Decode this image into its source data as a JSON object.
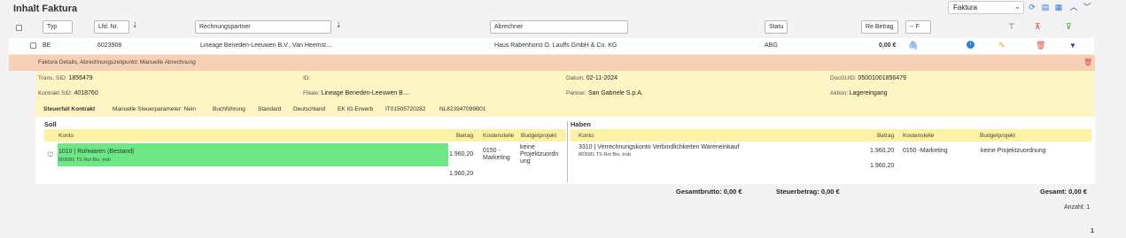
{
  "page": {
    "title": "Inhalt Faktura"
  },
  "toolbar": {
    "view_select": "Faktura"
  },
  "filters": {
    "typ": "Typ",
    "lfd_nr": "Lfd. Nr.",
    "rechnungspartner": "Rechnungspartner",
    "abrechner": "Abrechner",
    "status": "Statu",
    "re_betrag": "Re.Betrag",
    "f_select": "-- F"
  },
  "row": {
    "typ": "BE",
    "lfd_nr": "6023908",
    "rechnungspartner": "Lineage Beneden-Leeuwen B.V., Van Heemst…",
    "abrechner": "Haus Rabenhorst O. Lauffs GmbH & Co. KG",
    "status": "ABG",
    "betrag": "0,00 €"
  },
  "details": {
    "header": "Faktura Details, Abrechnungszeitpunkt: Manuelle Abrechnung",
    "trans_sid_label": "Trans. SID:",
    "trans_sid": "1856479",
    "id_label": "ID:",
    "id": "",
    "datum_label": "Datum:",
    "datum": "02-11-2024",
    "docguid_label": "DocGUID:",
    "docguid": "05001001856479",
    "kontrakt_label": "Kontrakt SID:",
    "kontrakt": "4018760",
    "filiale_label": "Filiale:",
    "filiale": "Lineage Beneden-Leeuwen B…",
    "partner_label": "Partner:",
    "partner": "San Gabriele S.p.A.",
    "aktion_label": "Aktion:",
    "aktion": "Lagereingang"
  },
  "tags": {
    "steuerfall": "Steuerfall Kontrakt",
    "manuell": "Manuelle Steuerparameter: Nein",
    "buchfuehrung": "Buchführung",
    "standard": "Standard",
    "land": "Deutschland",
    "ek": "EK IG-Erwerb",
    "it": "IT01505720282",
    "nl": "NL823947099B01"
  },
  "soll": {
    "title": "Soll",
    "columns": {
      "konto": "Konto",
      "betrag": "Betrag",
      "kostenstelle": "Kostenstelle",
      "budget": "Budgetprojekt"
    },
    "konto": "1010 | Rohwaren (Bestand)",
    "konto_sub": "803081 TS Rot Bio, trüb",
    "betrag": "1.960,20",
    "kostenstelle_1": "0150 -",
    "kostenstelle_2": "Marketing",
    "budget_1": "keine",
    "budget_2": "Projektzuordn",
    "budget_3": "ung",
    "sum": "1.960,20"
  },
  "haben": {
    "title": "Haben",
    "columns": {
      "konto": "Konto",
      "betrag": "Betrag",
      "kostenstelle": "Kostenstelle",
      "budget": "Budgetprojekt"
    },
    "konto": "3310 | Verrechnungskonto Verbindlichkeiten Wareneinkauf",
    "konto_sub": "803081 TS Rot Bio, trüb",
    "betrag": "1.960,20",
    "kostenstelle": "0150 -Marketing",
    "budget": "keine Projektzuordnung",
    "sum": "1.960,20"
  },
  "totals": {
    "gesamtbrutto": "Gesamtbrutto: 0,00 €",
    "steuerbetrag": "Steuerbetrag: 0,00 €",
    "gesamt": "Gesamt: 0,00 €",
    "anzahl_label": "Anzahl:",
    "anzahl": "1",
    "page": "1"
  },
  "colors": {
    "accent": "#2a7de1",
    "green": "#6ee884",
    "salmon": "#f8cfb7",
    "yellow": "#fdf5c4"
  }
}
